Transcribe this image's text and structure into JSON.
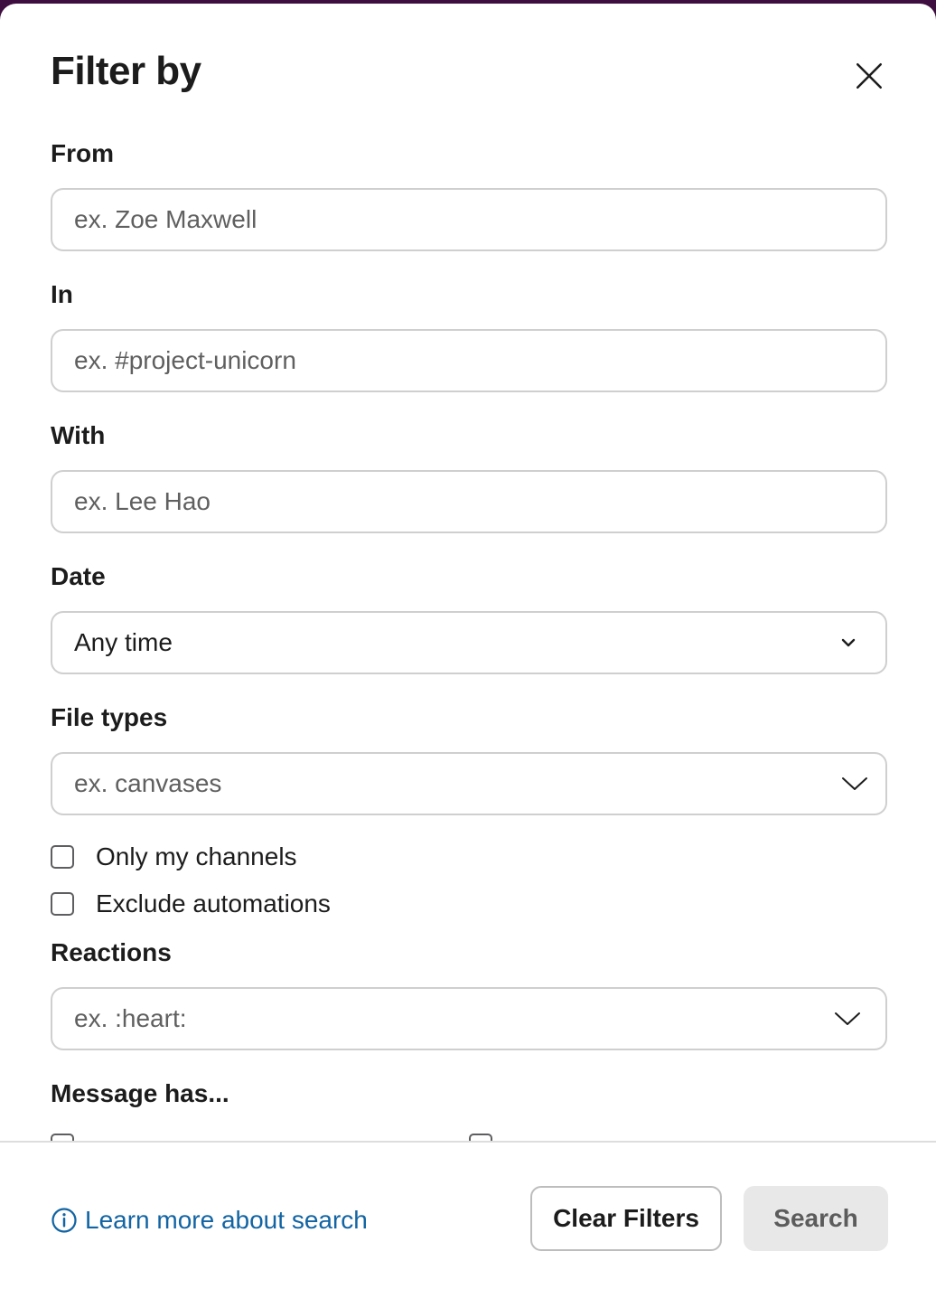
{
  "modal": {
    "title": "Filter by"
  },
  "fields": {
    "from": {
      "label": "From",
      "placeholder": "ex. Zoe Maxwell"
    },
    "in": {
      "label": "In",
      "placeholder": "ex. #project-unicorn"
    },
    "with": {
      "label": "With",
      "placeholder": "ex. Lee Hao"
    },
    "date": {
      "label": "Date",
      "value": "Any time"
    },
    "file_types": {
      "label": "File types",
      "placeholder": "ex. canvases"
    },
    "reactions": {
      "label": "Reactions",
      "placeholder": "ex. :heart:"
    }
  },
  "checkboxes": {
    "only_my_channels": {
      "label": "Only my channels",
      "checked": false
    },
    "exclude_automations": {
      "label": "Exclude automations",
      "checked": false
    }
  },
  "message_has": {
    "label": "Message has..."
  },
  "footer": {
    "learn_more": "Learn more about search",
    "clear_filters": "Clear Filters",
    "search": "Search"
  },
  "icons": {
    "close": "close-icon",
    "chevron": "chevron-down-icon",
    "info": "info-icon"
  },
  "colors": {
    "link": "#1264a3",
    "border": "#cfcfcf",
    "search_button_bg": "#e8e8e8"
  }
}
